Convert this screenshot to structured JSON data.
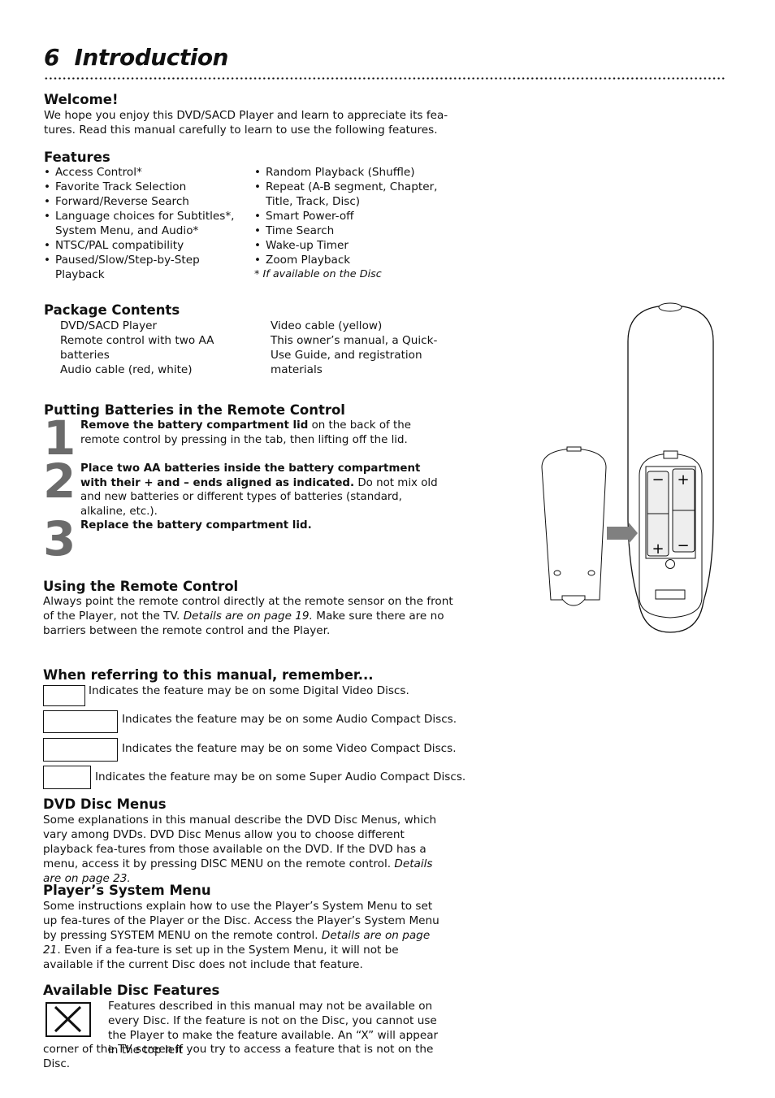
{
  "page": {
    "number": "6",
    "title": "Introduction"
  },
  "welcome": {
    "heading": "Welcome!",
    "text": "We hope you enjoy this DVD/SACD Player and learn to appreciate its fea-tures. Read this manual carefully to learn to use the following features."
  },
  "features": {
    "heading": "Features",
    "left": [
      "Access Control*",
      "Favorite Track Selection",
      "Forward/Reverse Search",
      "Language choices for Subtitles*, System Menu, and Audio*",
      "NTSC/PAL compatibility",
      "Paused/Slow/Step-by-Step Playback"
    ],
    "right": [
      "Random Playback (Shuffle)",
      "Repeat (A-B segment, Chapter, Title, Track, Disc)",
      "Smart Power-off",
      "Time Search",
      "Wake-up Timer",
      "Zoom Playback"
    ],
    "footnote": "* If available on the Disc"
  },
  "package": {
    "heading": "Package Contents",
    "left": [
      "DVD/SACD Player",
      "Remote control with two AA batteries",
      "Audio cable (red, white)"
    ],
    "right": [
      "Video cable (yellow)",
      "This owner’s manual, a Quick-Use Guide, and registration materials"
    ]
  },
  "batteries": {
    "heading": "Putting Batteries in the Remote Control",
    "steps": [
      {
        "num": "1",
        "bold": "Remove the battery compartment lid",
        "rest": " on the back of the remote control by pressing in the tab, then lifting off the lid."
      },
      {
        "num": "2",
        "bold": "Place two AA batteries inside the battery compartment with their + and – ends aligned as indicated.",
        "rest": " Do not mix old and new batteries or different types of batteries (standard, alkaline, etc.)."
      },
      {
        "num": "3",
        "bold": "Replace the battery compartment lid.",
        "rest": ""
      }
    ]
  },
  "using": {
    "heading": "Using the Remote Control",
    "text1": "Always point the remote control directly at the remote sensor on the front of the Player, not the TV. ",
    "ref": "Details are on page 19.",
    "text2": " Make sure there are no barriers between the remote control and the Player."
  },
  "referring": {
    "heading": "When referring to this manual, remember...",
    "items": [
      "Indicates the feature may be on some Digital Video Discs.",
      "Indicates the feature may be on some Audio Compact Discs.",
      "Indicates the feature may be on some Video Compact Discs.",
      "Indicates the feature may be on some Super Audio Compact Discs."
    ]
  },
  "dvd_menus": {
    "heading": "DVD Disc Menus",
    "text": "Some explanations in this manual describe the DVD Disc Menus, which vary among DVDs. DVD Disc Menus allow you to choose different playback fea-tures from those available on the DVD. If the DVD has a menu, access it by pressing DISC MENU on the remote control. ",
    "ref": "Details are on page 23."
  },
  "system_menu": {
    "heading": "Player’s System Menu",
    "text1": "Some instructions explain how to use the Player’s System Menu to set up fea-tures of the Player or the Disc. Access the Player’s System Menu by pressing SYSTEM MENU on the remote control. ",
    "ref": "Details are on page 21",
    "text2": ". Even if a fea-ture is set up in the System Menu, it will not be available if the current Disc does not include that feature."
  },
  "available": {
    "heading": "Available Disc Features",
    "text_top": "Features described in this manual may not be available on every Disc. If the feature is not on the Disc, you cannot use the Player to make the feature available. An “X” will appear in the top left",
    "text_bottom": "corner of the TV screen if you try to access a feature that is not on the Disc."
  },
  "illustration": {
    "battery_labels": {
      "minus": "−",
      "plus": "+"
    }
  },
  "colors": {
    "text": "#111111",
    "step_number": "#6b6b6b",
    "arrow": "#808080",
    "battery_fill": "#eeeeee"
  }
}
